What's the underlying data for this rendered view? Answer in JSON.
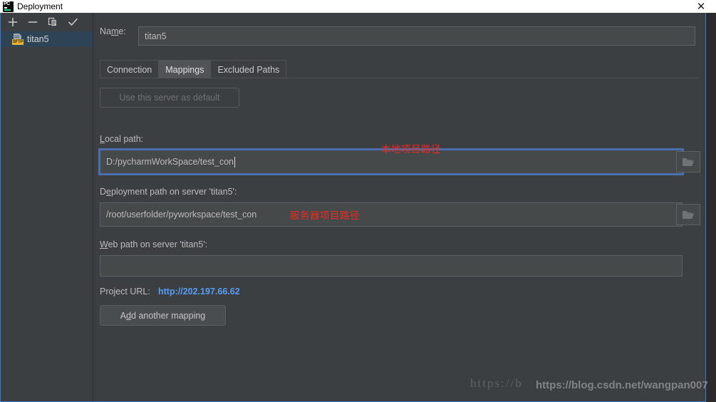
{
  "window": {
    "title": "Deployment",
    "app_icon": "pycharm-icon",
    "close_label": "✕"
  },
  "sidebar": {
    "toolbar": [
      {
        "name": "add-server-button",
        "icon": "plus-icon"
      },
      {
        "name": "remove-server-button",
        "icon": "minus-icon"
      },
      {
        "name": "copy-server-button",
        "icon": "copy-icon"
      },
      {
        "name": "set-default-button",
        "icon": "check-icon"
      }
    ],
    "servers": [
      {
        "name": "titan5",
        "protocol_badge": "SFTP",
        "selected": true
      }
    ]
  },
  "form": {
    "name_label": "Name:",
    "name_mnemonic": "m",
    "name_value": "titan5",
    "tabs": [
      {
        "label": "Connection",
        "active": false
      },
      {
        "label": "Mappings",
        "active": true
      },
      {
        "label": "Excluded Paths",
        "active": false
      }
    ],
    "use_default_button": "Use this server as default",
    "local_path_label": "Local path:",
    "local_path_mnemonic": "L",
    "local_path_value": "D:/pycharmWorkSpace/test_con",
    "deployment_path_label": "Deployment path on server 'titan5':",
    "deployment_path_mnemonic": "D",
    "deployment_path_value": "/root/userfolder/pyworkspace/test_con",
    "web_path_label": "Web path on server 'titan5':",
    "web_path_mnemonic": "W",
    "web_path_value": "",
    "project_url_label": "Project URL:",
    "project_url_value": "http://202.197.66.62",
    "add_mapping_button": "Add another mapping",
    "add_mapping_mnemonic": "d",
    "browse_icon": "folder-icon"
  },
  "annotations": [
    {
      "text": "本地项目路径",
      "color": "#ee2a22"
    },
    {
      "text": "服务器项目路径",
      "color": "#ee2a22"
    }
  ],
  "watermarks": {
    "serif": "https://b",
    "sans": "https://blog.csdn.net/wangpan007"
  },
  "colors": {
    "panel_bg": "#3c3f41",
    "field_bg": "#45494a",
    "focus_blue": "#4b6eaf",
    "link_blue": "#589df6",
    "annotation_red": "#ee2a22",
    "selection_blue": "#2f4356",
    "badge_yellow": "#e8b233"
  }
}
